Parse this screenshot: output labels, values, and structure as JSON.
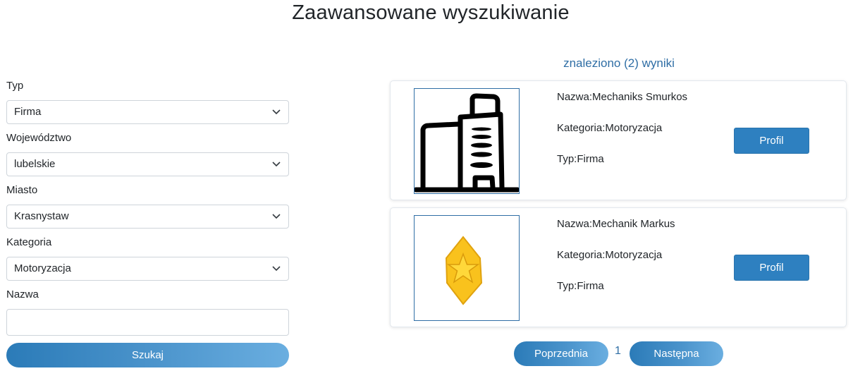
{
  "page": {
    "title": "Zaawansowane wyszukiwanie"
  },
  "filters": {
    "type": {
      "label": "Typ",
      "value": "Firma"
    },
    "voivodeship": {
      "label": "Województwo",
      "value": "lubelskie"
    },
    "city": {
      "label": "Miasto",
      "value": "Krasnystaw"
    },
    "category": {
      "label": "Kategoria",
      "value": "Motoryzacja"
    },
    "name": {
      "label": "Nazwa",
      "value": "",
      "placeholder": ""
    },
    "search_label": "Szukaj"
  },
  "results": {
    "count_text": "znaleziono (2) wyniki",
    "items": [
      {
        "name": "Nazwa:Mechaniks Smurkos",
        "category": "Kategoria:Motoryzacja",
        "type": "Typ:Firma",
        "profile_label": "Profil",
        "image_icon": "building-icon"
      },
      {
        "name": "Nazwa:Mechanik Markus",
        "category": "Kategoria:Motoryzacja",
        "type": "Typ:Firma",
        "profile_label": "Profil",
        "image_icon": "star-badge-icon"
      }
    ]
  },
  "pagination": {
    "prev_label": "Poprzednia",
    "current_page": "1",
    "next_label": "Następna"
  },
  "colors": {
    "accent": "#2e80c0",
    "link_text": "#2f6ea5",
    "badge_fill": "#f9c21d"
  }
}
